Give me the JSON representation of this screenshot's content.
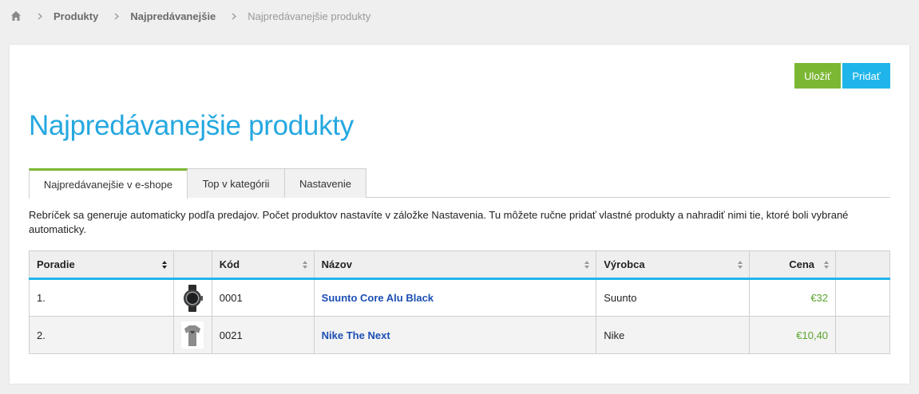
{
  "breadcrumb": {
    "items": [
      "Produkty",
      "Najpredávanejšie"
    ],
    "current": "Najpredávanejšie produkty"
  },
  "actions": {
    "save_label": "Uložiť",
    "add_label": "Pridať"
  },
  "page": {
    "title": "Najpredávanejšie produkty"
  },
  "tabs": [
    {
      "label": "Najpredávanejšie v e-shope",
      "active": true
    },
    {
      "label": "Top v kategórii",
      "active": false
    },
    {
      "label": "Nastavenie",
      "active": false
    }
  ],
  "description": "Rebríček sa generuje automaticky podľa predajov. Počet produktov nastavíte v záložke Nastavenia. Tu môžete ručne pridať vlastné produkty a nahradiť nimi tie, ktoré boli vybrané automaticky.",
  "table": {
    "columns": [
      "Poradie",
      "",
      "Kód",
      "Názov",
      "Výrobca",
      "Cena",
      ""
    ],
    "rows": [
      {
        "rank": "1.",
        "image": "watch-thumbnail",
        "code": "0001",
        "name": "Suunto Core Alu Black",
        "manufacturer": "Suunto",
        "price": "€32"
      },
      {
        "rank": "2.",
        "image": "tshirt-thumbnail",
        "code": "0021",
        "name": "Nike The Next",
        "manufacturer": "Nike",
        "price": "€10,40"
      }
    ]
  },
  "colors": {
    "accent_blue": "#25a8e0",
    "save_green": "#7cb733",
    "add_blue": "#1fb5ea",
    "price_green": "#5aa22b",
    "link_blue": "#1c4fb3"
  }
}
